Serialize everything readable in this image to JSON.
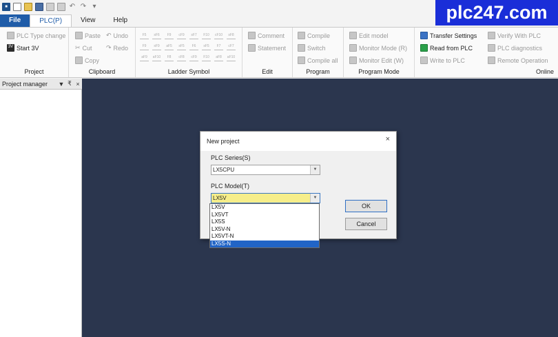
{
  "brand": "plc247.com",
  "menu": {
    "file": "File",
    "plc": "PLC(P)",
    "view": "View",
    "help": "Help"
  },
  "ribbon": {
    "project": {
      "label": "Project",
      "plc_type_change": "PLC Type change",
      "start_3v": "Start 3V",
      "start_3v_icon": "3V"
    },
    "clipboard": {
      "label": "Clipboard",
      "paste": "Paste",
      "undo": "Undo",
      "cut": "Cut",
      "redo": "Redo",
      "copy": "Copy"
    },
    "ladder": {
      "label": "Ladder Symbol",
      "symbols": [
        "F5",
        "sF6",
        "F9",
        "cF9",
        "sF7",
        "F10",
        "cF10",
        "sF8",
        "F9",
        "sF9",
        "aF5",
        "sF5",
        "F6",
        "sF5",
        "F7",
        "cF7",
        "aF9",
        "aF10",
        "F8",
        "cF8",
        "cF9",
        "F10",
        "aF8",
        "aF10"
      ]
    },
    "edit": {
      "label": "Edit",
      "comment": "Comment",
      "statement": "Statement"
    },
    "program": {
      "label": "Program",
      "compile": "Compile",
      "switch": "Switch",
      "compile_all": "Compile all"
    },
    "program_mode": {
      "label": "Program Mode",
      "edit_model": "Edit model",
      "monitor_mode": "Monitor Mode (R)",
      "monitor_edit": "Monitor Edit (W)"
    },
    "online": {
      "label": "Online",
      "transfer_settings": "Transfer Settings",
      "read_from_plc": "Read from PLC",
      "write_to_plc": "Write to PLC",
      "verify_with_plc": "Verify With PLC",
      "plc_diagnostics": "PLC diagnostics",
      "remote_operation": "Remote Operation"
    }
  },
  "project_manager": {
    "title": "Project manager",
    "pin": "▼",
    "dock": "₹",
    "close": "×"
  },
  "dialog": {
    "title": "New project",
    "close": "×",
    "series_label": "PLC Series(S)",
    "series_value": "LX5CPU",
    "model_label": "PLC Model(T)",
    "model_value": "LX5V",
    "ok": "OK",
    "cancel": "Cancel",
    "model_options": [
      "LX5V",
      "LX5VT",
      "LX5S",
      "LX5V-N",
      "LX5VT-N",
      "LX5S-N"
    ],
    "selected_option": "LX5S-N"
  }
}
